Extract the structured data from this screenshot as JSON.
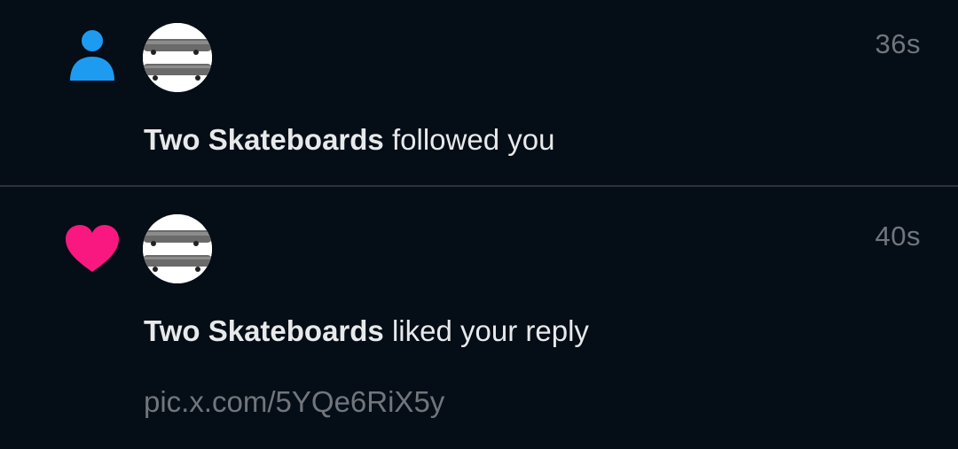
{
  "colors": {
    "background": "#050d17",
    "divider": "#2f3336",
    "primary_text": "#e7e9ea",
    "secondary_text": "#71767b",
    "follow_icon": "#1d9bf0",
    "like_icon": "#f91880"
  },
  "notifications": [
    {
      "type_icon": "person-icon",
      "actor": "Two Skateboards",
      "action": "followed you",
      "time": "36s"
    },
    {
      "type_icon": "heart-icon",
      "actor": "Two Skateboards",
      "action": "liked your reply",
      "time": "40s",
      "link": "pic.x.com/5YQe6RiX5y"
    }
  ]
}
